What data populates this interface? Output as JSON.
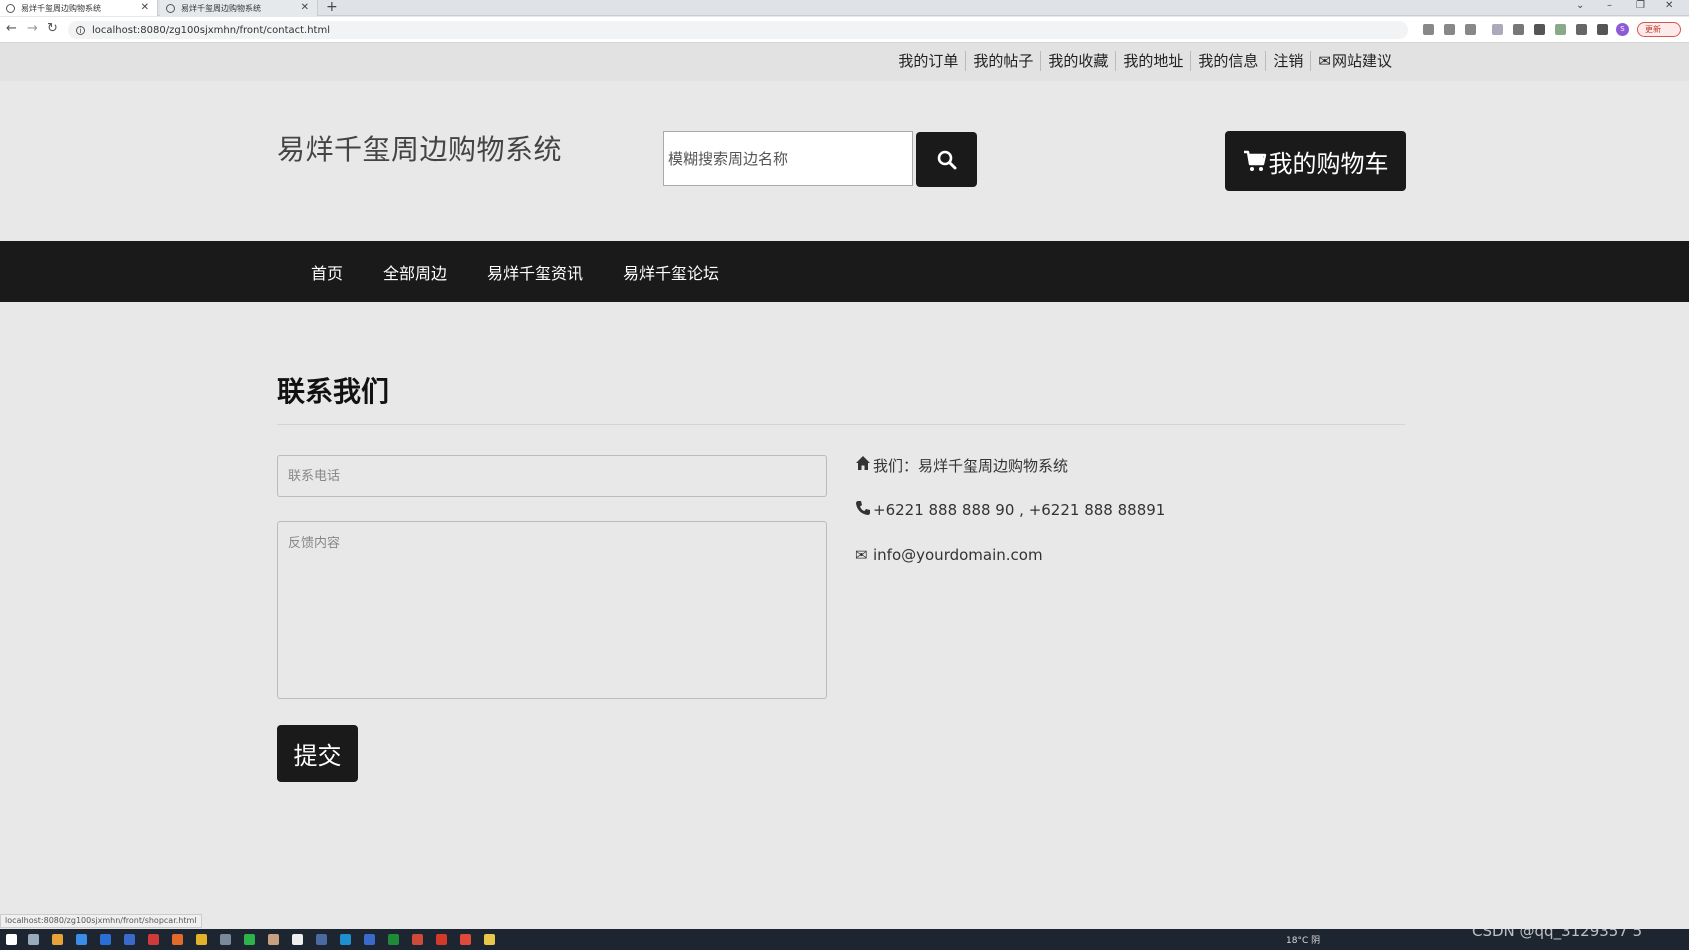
{
  "browser": {
    "tabs": [
      {
        "title": "易烊千玺周边购物系统"
      },
      {
        "title": "易烊千玺周边购物系统"
      }
    ],
    "url": "localhost:8080/zg100sjxmhn/front/contact.html",
    "update_label": "更新"
  },
  "topnav": {
    "links": [
      "我的订单",
      "我的帖子",
      "我的收藏",
      "我的地址",
      "我的信息",
      "注销",
      "网站建议"
    ]
  },
  "header": {
    "logo": "易烊千玺周边购物系统",
    "search_placeholder": "模糊搜索周边名称",
    "cart_label": "我的购物车"
  },
  "mainnav": {
    "items": [
      "首页",
      "全部周边",
      "易烊千玺资讯",
      "易烊千玺论坛"
    ]
  },
  "contact": {
    "title": "联系我们",
    "phone_placeholder": "联系电话",
    "feedback_placeholder": "反馈内容",
    "submit_label": "提交",
    "address": "我们：易烊千玺周边购物系统",
    "phone": "+6221 888 888 90 , +6221 888 88891",
    "email": "info@yourdomain.com"
  },
  "statusbar": {
    "link": "localhost:8080/zg100sjxmhn/front/shopcar.html"
  },
  "taskbar": {
    "weather": "18°C 阴",
    "watermark": "CSDN @qq_3129357 5"
  },
  "colors": {
    "dark": "#1a1a1a",
    "page_bg": "#e8e8e8"
  }
}
